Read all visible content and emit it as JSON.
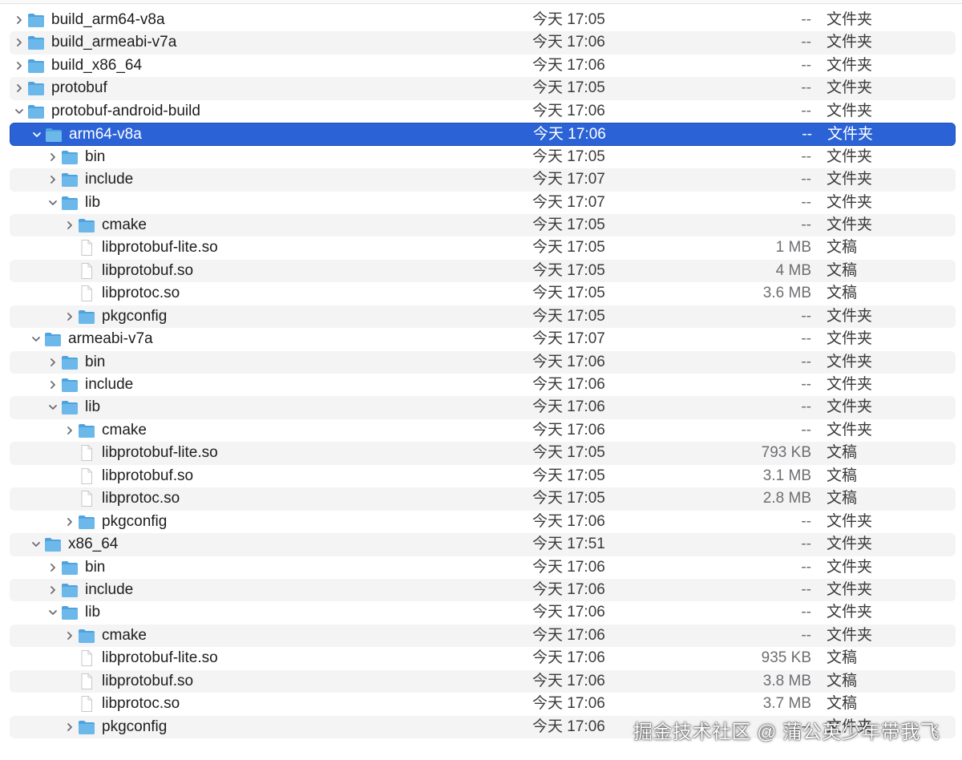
{
  "colors": {
    "selection": "#2b63d6",
    "folder": "#6cb8ea",
    "folder_tab": "#4fa3dd",
    "file": "#ffffff"
  },
  "rows": [
    {
      "name": "build_arm64-v8a",
      "date": "今天 17:05",
      "size": "--",
      "kind": "文件夹",
      "type": "folder",
      "depth": 0,
      "expanded": false
    },
    {
      "name": "build_armeabi-v7a",
      "date": "今天 17:06",
      "size": "--",
      "kind": "文件夹",
      "type": "folder",
      "depth": 0,
      "expanded": false
    },
    {
      "name": "build_x86_64",
      "date": "今天 17:06",
      "size": "--",
      "kind": "文件夹",
      "type": "folder",
      "depth": 0,
      "expanded": false
    },
    {
      "name": "protobuf",
      "date": "今天 17:05",
      "size": "--",
      "kind": "文件夹",
      "type": "folder",
      "depth": 0,
      "expanded": false
    },
    {
      "name": "protobuf-android-build",
      "date": "今天 17:06",
      "size": "--",
      "kind": "文件夹",
      "type": "folder",
      "depth": 0,
      "expanded": true
    },
    {
      "name": "arm64-v8a",
      "date": "今天 17:06",
      "size": "--",
      "kind": "文件夹",
      "type": "folder",
      "depth": 1,
      "expanded": true,
      "selected": true
    },
    {
      "name": "bin",
      "date": "今天 17:05",
      "size": "--",
      "kind": "文件夹",
      "type": "folder",
      "depth": 2,
      "expanded": false
    },
    {
      "name": "include",
      "date": "今天 17:07",
      "size": "--",
      "kind": "文件夹",
      "type": "folder",
      "depth": 2,
      "expanded": false
    },
    {
      "name": "lib",
      "date": "今天 17:07",
      "size": "--",
      "kind": "文件夹",
      "type": "folder",
      "depth": 2,
      "expanded": true
    },
    {
      "name": "cmake",
      "date": "今天 17:05",
      "size": "--",
      "kind": "文件夹",
      "type": "folder",
      "depth": 3,
      "expanded": false
    },
    {
      "name": "libprotobuf-lite.so",
      "date": "今天 17:05",
      "size": "1 MB",
      "kind": "文稿",
      "type": "file",
      "depth": 3
    },
    {
      "name": "libprotobuf.so",
      "date": "今天 17:05",
      "size": "4 MB",
      "kind": "文稿",
      "type": "file",
      "depth": 3
    },
    {
      "name": "libprotoc.so",
      "date": "今天 17:05",
      "size": "3.6 MB",
      "kind": "文稿",
      "type": "file",
      "depth": 3
    },
    {
      "name": "pkgconfig",
      "date": "今天 17:05",
      "size": "--",
      "kind": "文件夹",
      "type": "folder",
      "depth": 3,
      "expanded": false
    },
    {
      "name": "armeabi-v7a",
      "date": "今天 17:07",
      "size": "--",
      "kind": "文件夹",
      "type": "folder",
      "depth": 1,
      "expanded": true
    },
    {
      "name": "bin",
      "date": "今天 17:06",
      "size": "--",
      "kind": "文件夹",
      "type": "folder",
      "depth": 2,
      "expanded": false
    },
    {
      "name": "include",
      "date": "今天 17:06",
      "size": "--",
      "kind": "文件夹",
      "type": "folder",
      "depth": 2,
      "expanded": false
    },
    {
      "name": "lib",
      "date": "今天 17:06",
      "size": "--",
      "kind": "文件夹",
      "type": "folder",
      "depth": 2,
      "expanded": true
    },
    {
      "name": "cmake",
      "date": "今天 17:06",
      "size": "--",
      "kind": "文件夹",
      "type": "folder",
      "depth": 3,
      "expanded": false
    },
    {
      "name": "libprotobuf-lite.so",
      "date": "今天 17:05",
      "size": "793 KB",
      "kind": "文稿",
      "type": "file",
      "depth": 3
    },
    {
      "name": "libprotobuf.so",
      "date": "今天 17:05",
      "size": "3.1 MB",
      "kind": "文稿",
      "type": "file",
      "depth": 3
    },
    {
      "name": "libprotoc.so",
      "date": "今天 17:05",
      "size": "2.8 MB",
      "kind": "文稿",
      "type": "file",
      "depth": 3
    },
    {
      "name": "pkgconfig",
      "date": "今天 17:06",
      "size": "--",
      "kind": "文件夹",
      "type": "folder",
      "depth": 3,
      "expanded": false
    },
    {
      "name": "x86_64",
      "date": "今天 17:51",
      "size": "--",
      "kind": "文件夹",
      "type": "folder",
      "depth": 1,
      "expanded": true
    },
    {
      "name": "bin",
      "date": "今天 17:06",
      "size": "--",
      "kind": "文件夹",
      "type": "folder",
      "depth": 2,
      "expanded": false
    },
    {
      "name": "include",
      "date": "今天 17:06",
      "size": "--",
      "kind": "文件夹",
      "type": "folder",
      "depth": 2,
      "expanded": false
    },
    {
      "name": "lib",
      "date": "今天 17:06",
      "size": "--",
      "kind": "文件夹",
      "type": "folder",
      "depth": 2,
      "expanded": true
    },
    {
      "name": "cmake",
      "date": "今天 17:06",
      "size": "--",
      "kind": "文件夹",
      "type": "folder",
      "depth": 3,
      "expanded": false
    },
    {
      "name": "libprotobuf-lite.so",
      "date": "今天 17:06",
      "size": "935 KB",
      "kind": "文稿",
      "type": "file",
      "depth": 3
    },
    {
      "name": "libprotobuf.so",
      "date": "今天 17:06",
      "size": "3.8 MB",
      "kind": "文稿",
      "type": "file",
      "depth": 3
    },
    {
      "name": "libprotoc.so",
      "date": "今天 17:06",
      "size": "3.7 MB",
      "kind": "文稿",
      "type": "file",
      "depth": 3
    },
    {
      "name": "pkgconfig",
      "date": "今天 17:06",
      "size": "--",
      "kind": "文件夹",
      "type": "folder",
      "depth": 3,
      "expanded": false
    }
  ],
  "watermark": "掘金技术社区 @ 蒲公英少年带我飞"
}
